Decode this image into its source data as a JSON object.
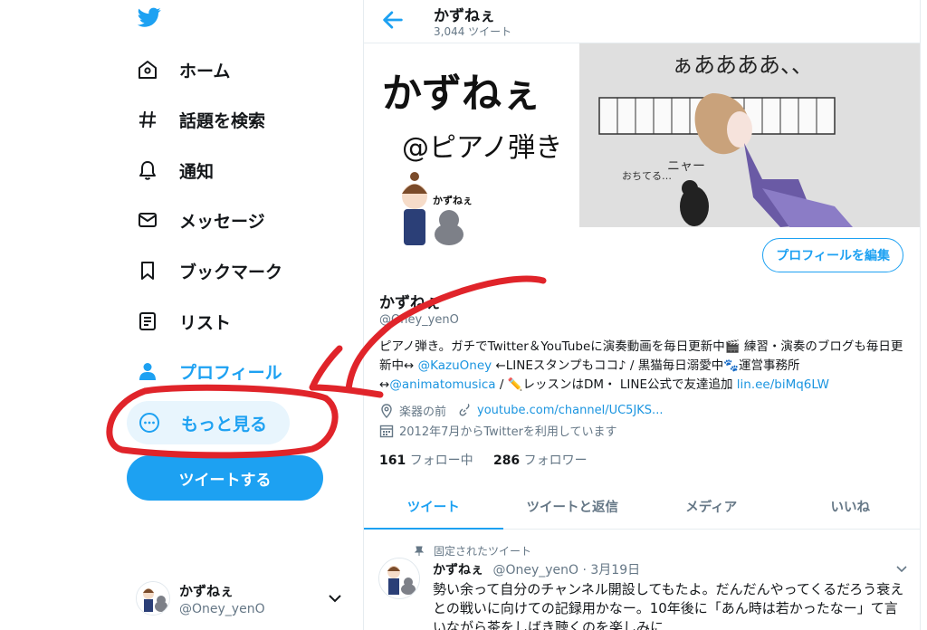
{
  "colors": {
    "accent": "#1da1f2",
    "text": "#14171a",
    "muted": "#657786",
    "annotation": "#e0242a"
  },
  "sidebar": {
    "logo": "twitter-bird-icon",
    "items": [
      {
        "label": "ホーム",
        "icon": "home-icon"
      },
      {
        "label": "話題を検索",
        "icon": "hashtag-icon"
      },
      {
        "label": "通知",
        "icon": "bell-icon"
      },
      {
        "label": "メッセージ",
        "icon": "envelope-icon"
      },
      {
        "label": "ブックマーク",
        "icon": "bookmark-icon"
      },
      {
        "label": "リスト",
        "icon": "list-icon"
      },
      {
        "label": "プロフィール",
        "icon": "person-icon"
      },
      {
        "label": "もっと見る",
        "icon": "more-dots-icon"
      }
    ],
    "tweet_button": "ツイートする",
    "account": {
      "name": "かずねぇ",
      "handle": "@Oney_yenO"
    }
  },
  "header": {
    "title": "かずねぇ",
    "tweet_count": "3,044 ツイート"
  },
  "banner": {
    "text_line1": "かずねぇ",
    "text_line2": "@ピアノ弾き",
    "drawing_text_top": "ぁああああ、、",
    "drawing_text_meow": "ニャー",
    "drawing_text_side": "おちてる…"
  },
  "profile": {
    "avatar_text": "かずねぇ",
    "edit_button": "プロフィールを編集",
    "name": "かずねぇ",
    "handle": "@Oney_yenO",
    "bio_part1": "ピアノ弾き。ガチでTwitter＆YouTubeに演奏動画を毎日更新中🎬 練習・演奏のブログも毎日更新中↔ ",
    "bio_link1": "@KazuOney",
    "bio_part2": " ←LINEスタンプもココ♪ / 黒猫毎日溺愛中🐾運営事務所↔",
    "bio_link2": "@animatomusica",
    "bio_part3": " /  ✏️レッスンはDM・ LINE公式で友達追加 ",
    "bio_link3": "lin.ee/biMq6LW",
    "location": "楽器の前",
    "website": "youtube.com/channel/UC5JKS...",
    "joined": "2012年7月からTwitterを利用しています",
    "following_count": "161",
    "following_label": "フォロー中",
    "followers_count": "286",
    "followers_label": "フォロワー"
  },
  "tabs": [
    "ツイート",
    "ツイートと返信",
    "メディア",
    "いいね"
  ],
  "pinned_tweet": {
    "pinned_label": "固定されたツイート",
    "name": "かずねぇ",
    "handle_date": "@Oney_yenO · 3月19日",
    "text": "勢い余って自分のチャンネル開設してもたよ。だんだんやってくるだろう衰えとの戦いに向けての記録用かなー。10年後に「あん時は若かったなー」て言いながら茶をしばき聴くのを楽しみに"
  }
}
